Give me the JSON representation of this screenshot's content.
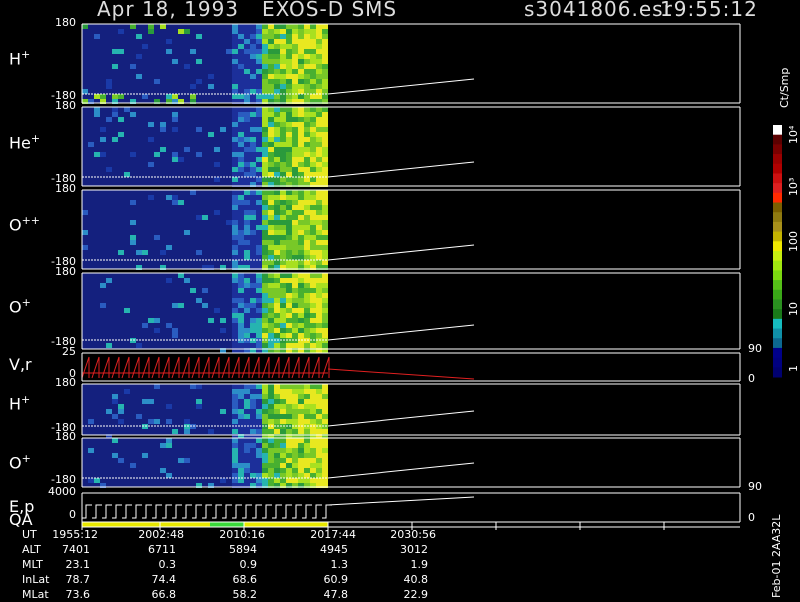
{
  "header": {
    "date": "Apr 18, 1993",
    "instrument": "EXOS-D SMS",
    "filename": "s3041806.esr",
    "time": "19:55:12"
  },
  "panels": [
    {
      "label": "H",
      "sup": "+",
      "top_tick": "180",
      "bottom_tick": "-180"
    },
    {
      "label": "He",
      "sup": "+",
      "top_tick": "180",
      "bottom_tick": "-180"
    },
    {
      "label": "O",
      "sup": "++",
      "top_tick": "180",
      "bottom_tick": "-180"
    },
    {
      "label": "O",
      "sup": "+",
      "top_tick": "180",
      "bottom_tick": "-180"
    },
    {
      "label": "V,r",
      "sup": "",
      "top_tick": "25",
      "bottom_tick": "0"
    },
    {
      "label": "H",
      "sup": "+",
      "top_tick": "180",
      "bottom_tick": "-180"
    },
    {
      "label": "O",
      "sup": "+",
      "top_tick": "180",
      "bottom_tick": "-180"
    },
    {
      "label": "E,p",
      "sup": "",
      "top_tick": "4000",
      "bottom_tick": "0",
      "extra_label": "QA"
    }
  ],
  "right_ticks": {
    "vr_top": "90",
    "vr_bottom": "0",
    "ep_top": "90",
    "ep_bottom": "0"
  },
  "colorbar": {
    "unit": "Ct/Smp",
    "labels": [
      "10⁴",
      "10³",
      "100",
      "10",
      "1"
    ],
    "colors": [
      "#ffffff",
      "#5c0000",
      "#7a0000",
      "#9a0000",
      "#b00000",
      "#cc1010",
      "#dd2020",
      "#ff2a00",
      "#7a5f00",
      "#8f7a10",
      "#a8901a",
      "#c4b300",
      "#f0e800",
      "#c8ee10",
      "#a2e810",
      "#7cd810",
      "#56c018",
      "#3aa818",
      "#2a9020",
      "#1a7a1a",
      "#16bcc0",
      "#1090a8",
      "#0c6890",
      "#00008a",
      "#000080",
      "#000070"
    ]
  },
  "footer_code": "Feb-01 2AA32L",
  "table": {
    "headers": [
      "1955:12",
      "2002:48",
      "2010:16",
      "2017:44",
      "2030:56"
    ],
    "rows": [
      {
        "name": "UT",
        "values": [
          "1955:12",
          "2002:48",
          "2010:16",
          "2017:44",
          "2030:56"
        ]
      },
      {
        "name": "ALT",
        "values": [
          "7401",
          "6711",
          "5894",
          "4945",
          "3012"
        ]
      },
      {
        "name": "MLT",
        "values": [
          "23.1",
          "0.3",
          "0.9",
          "1.3",
          "1.9"
        ]
      },
      {
        "name": "InLat",
        "values": [
          "78.7",
          "74.4",
          "68.6",
          "60.9",
          "40.8"
        ]
      },
      {
        "name": "MLat",
        "values": [
          "73.6",
          "66.8",
          "58.2",
          "47.8",
          "22.9"
        ]
      }
    ]
  }
}
